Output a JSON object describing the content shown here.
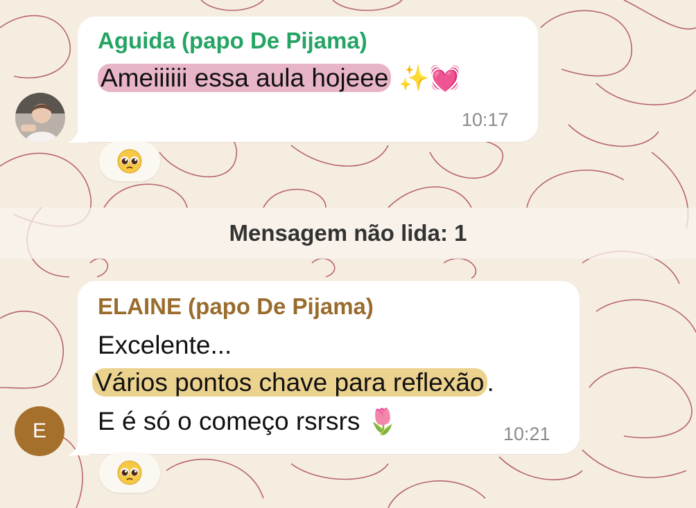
{
  "chat": {
    "messages": [
      {
        "sender": "Aguida (papo De Pijama)",
        "sender_color": "#25a464",
        "highlighted_text": "Ameiiiiii essa aula hojeee",
        "trailing_emojis": "✨💓",
        "time": "10:17",
        "reaction_icon": "pleading-face-icon",
        "avatar_icon": "profile-photo"
      },
      {
        "sender": "ELAINE (papo De Pijama)",
        "sender_color": "#996c2d",
        "line1": "Excelente...",
        "line2_highlighted": "Vários pontos chave para reflexão",
        "line2_end": ".",
        "line3": "E é só o começo rsrsrs",
        "trailing_emoji": "🌷",
        "time": "10:21",
        "avatar_letter": "E",
        "reaction_icon": "pleading-face-icon"
      }
    ],
    "unread_divider": "Mensagem não lida: 1"
  },
  "colors": {
    "wallpaper": "#f6ede1",
    "wallpaper_doodle": "#a0383f",
    "bubble": "#ffffff",
    "highlight_pink": "#e8b4c8",
    "highlight_yellow": "#ecd28f"
  }
}
